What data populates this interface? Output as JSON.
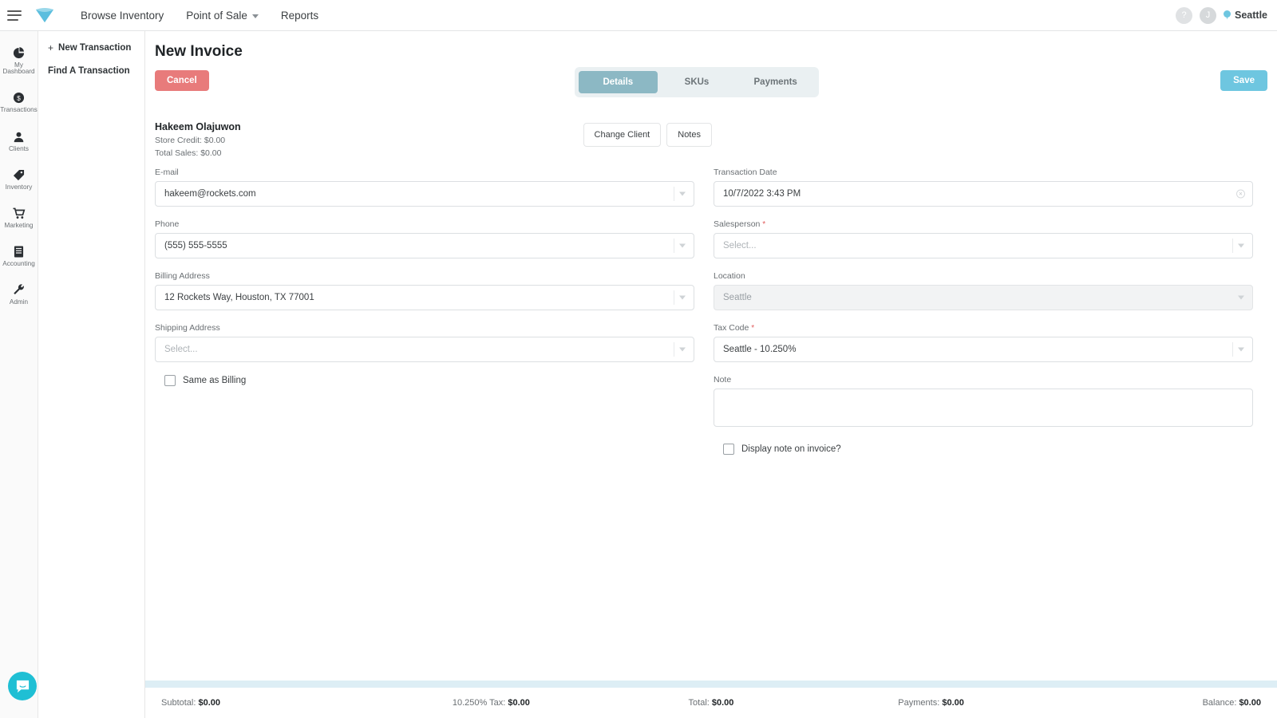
{
  "topbar": {
    "menu_icon": "hamburger-icon",
    "logo_icon": "gem-logo-icon",
    "nav": [
      {
        "label": "Browse Inventory",
        "has_caret": false
      },
      {
        "label": "Point of Sale",
        "has_caret": true
      },
      {
        "label": "Reports",
        "has_caret": false
      }
    ],
    "help_label": "?",
    "avatar_label": "J",
    "location_label": "Seattle"
  },
  "rail": {
    "items": [
      {
        "label": "My Dashboard",
        "icon": "pie-chart-icon"
      },
      {
        "label": "Transactions",
        "icon": "dollar-coin-icon"
      },
      {
        "label": "Clients",
        "icon": "person-icon"
      },
      {
        "label": "Inventory",
        "icon": "tag-icon"
      },
      {
        "label": "Marketing",
        "icon": "shopping-cart-icon"
      },
      {
        "label": "Accounting",
        "icon": "ledger-book-icon"
      },
      {
        "label": "Admin",
        "icon": "wrench-icon"
      }
    ]
  },
  "subnav": {
    "items": [
      {
        "label": "New Transaction",
        "prefix": "+"
      },
      {
        "label": "Find A Transaction",
        "prefix": ""
      }
    ]
  },
  "page": {
    "title": "New Invoice",
    "cancel_label": "Cancel",
    "save_label": "Save",
    "tabs": [
      {
        "label": "Details",
        "active": true
      },
      {
        "label": "SKUs",
        "active": false
      },
      {
        "label": "Payments",
        "active": false
      }
    ]
  },
  "client": {
    "name": "Hakeem Olajuwon",
    "store_credit": "Store Credit: $0.00",
    "total_sales": "Total Sales: $0.00",
    "change_client_label": "Change Client",
    "notes_label": "Notes"
  },
  "left_form": {
    "email": {
      "label": "E-mail",
      "value": "hakeem@rockets.com"
    },
    "phone": {
      "label": "Phone",
      "value": "(555) 555-5555"
    },
    "billing_address": {
      "label": "Billing Address",
      "value": "12 Rockets Way, Houston, TX 77001"
    },
    "shipping_address": {
      "label": "Shipping Address",
      "placeholder": "Select..."
    },
    "same_as_billing": {
      "label": "Same as Billing",
      "checked": false
    }
  },
  "right_form": {
    "transaction_date": {
      "label": "Transaction Date",
      "value": "10/7/2022 3:43 PM",
      "clear_icon": "clear-circle-icon"
    },
    "salesperson": {
      "label": "Salesperson",
      "required": "*",
      "placeholder": "Select..."
    },
    "location": {
      "label": "Location",
      "value": "Seattle",
      "disabled": true
    },
    "tax_code": {
      "label": "Tax Code",
      "required": "*",
      "value": "Seattle - 10.250%"
    },
    "note": {
      "label": "Note",
      "value": ""
    },
    "display_note": {
      "label": "Display note on invoice?",
      "checked": false
    }
  },
  "footer": {
    "subtotal_label": "Subtotal:",
    "subtotal_value": "$0.00",
    "tax_label": "10.250% Tax:",
    "tax_value": "$0.00",
    "total_label": "Total:",
    "total_value": "$0.00",
    "payments_label": "Payments:",
    "payments_value": "$0.00",
    "balance_label": "Balance:",
    "balance_value": "$0.00"
  },
  "chat": {
    "icon": "chat-bubble-icon"
  },
  "colors": {
    "accent": "#6ec6e0",
    "danger": "#e87b7b",
    "tab_active": "#8cb8c4",
    "footer_accent": "#ddeef5",
    "chat": "#1fbfd4"
  }
}
